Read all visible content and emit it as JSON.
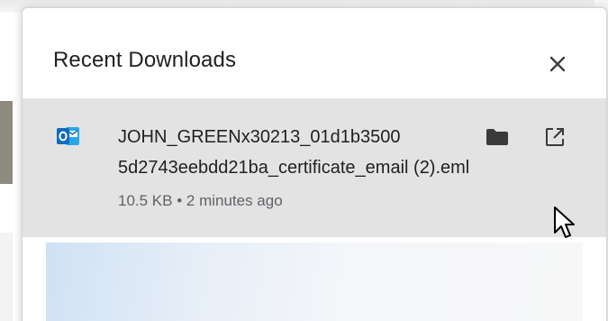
{
  "window": {
    "title": "Recent Downloads"
  },
  "actions": {
    "close_icon": "close-icon"
  },
  "download": {
    "app_icon": "outlook-icon",
    "file_name_line1": "JOHN_GREENx30213_01d1b3500",
    "file_name_line2": "5d2743eebdd21ba_certificate_email (2).eml",
    "meta": "10.5 KB • 2 minutes ago",
    "folder_icon": "folder-icon",
    "open_icon": "open-external-icon"
  },
  "colors": {
    "selected_row": "#e3e3e3",
    "outlook_blue": "#0f6cbd",
    "text_primary": "#202124",
    "text_secondary": "#5f6368"
  }
}
